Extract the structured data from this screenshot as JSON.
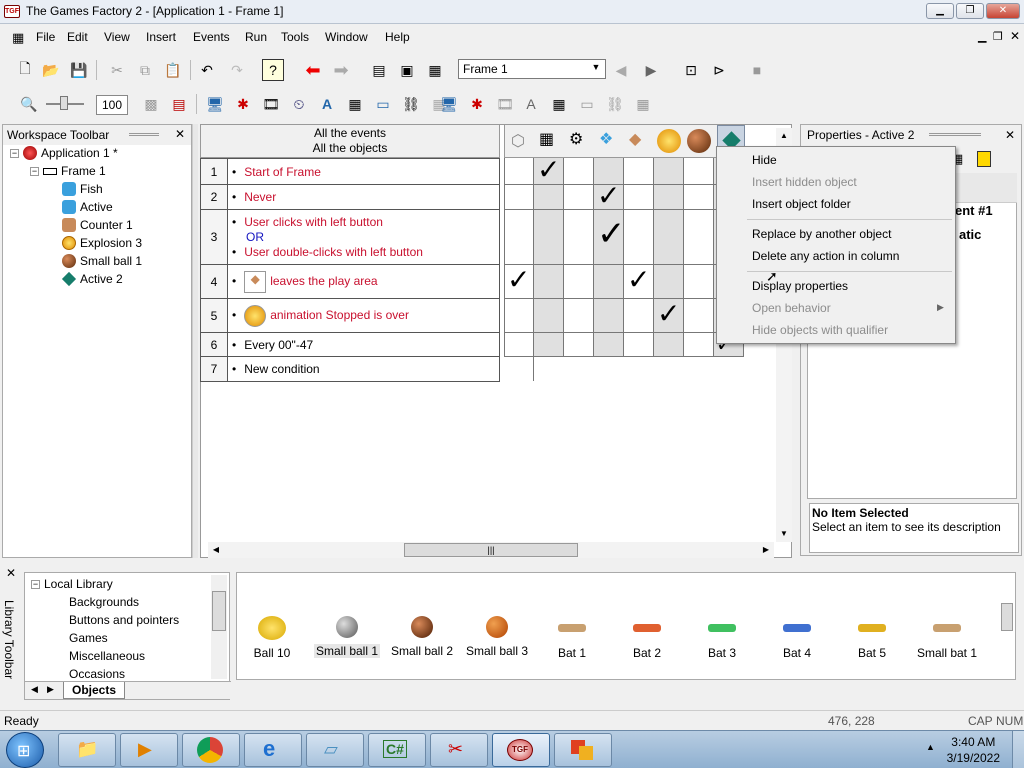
{
  "window": {
    "title": "The Games Factory 2 - [Application 1 - Frame 1]",
    "app_icon": "tgf-logo"
  },
  "menu": [
    "File",
    "Edit",
    "View",
    "Insert",
    "Events",
    "Run",
    "Tools",
    "Window",
    "Help"
  ],
  "toolbar": {
    "frame_select": "Frame 1",
    "zoom": "100"
  },
  "workspace": {
    "header": "Workspace Toolbar",
    "items": [
      {
        "label": "Application 1 *"
      },
      {
        "label": "Frame 1"
      },
      {
        "label": "Fish"
      },
      {
        "label": "Active"
      },
      {
        "label": "Counter 1"
      },
      {
        "label": "Explosion 3"
      },
      {
        "label": "Small ball 1"
      },
      {
        "label": "Active 2"
      }
    ]
  },
  "event_editor": {
    "header_line1": "All the events",
    "header_line2": "All the objects",
    "rows": [
      {
        "num": "1",
        "text": "Start of Frame"
      },
      {
        "num": "2",
        "text": "Never"
      },
      {
        "num": "3",
        "line1": "User clicks with left button",
        "or": "OR",
        "line2": "User double-clicks with left button"
      },
      {
        "num": "4",
        "text": "leaves the play area"
      },
      {
        "num": "5",
        "text": "animation Stopped is over"
      },
      {
        "num": "6",
        "text": "Every 00\"-47"
      },
      {
        "num": "7",
        "text": "New condition"
      }
    ]
  },
  "context_menu": {
    "items": [
      {
        "label": "Hide",
        "enabled": true
      },
      {
        "label": "Insert hidden object",
        "enabled": false
      },
      {
        "label": "Insert object folder",
        "enabled": true
      },
      {
        "label": "Replace by another object",
        "enabled": true
      },
      {
        "label": "Delete any action in column",
        "enabled": true
      },
      {
        "label": "Display properties",
        "enabled": true
      },
      {
        "label": "Open behavior",
        "enabled": false
      },
      {
        "label": "Hide objects with qualifier",
        "enabled": false
      }
    ]
  },
  "properties": {
    "header": "Properties - Active 2",
    "peek1": "ent #1",
    "peek2": "atic",
    "desc_title": "No Item Selected",
    "desc_text": "Select an item to see its description"
  },
  "library": {
    "side_label": "Library Toolbar",
    "tree": [
      "Local Library",
      "Backgrounds",
      "Buttons and pointers",
      "Games",
      "Miscellaneous",
      "Occasions"
    ],
    "tab": "Objects",
    "items": [
      "Ball 10",
      "Small ball 1",
      "Small ball 2",
      "Small ball 3",
      "Bat 1",
      "Bat 2",
      "Bat 3",
      "Bat 4",
      "Bat 5",
      "Small bat 1"
    ]
  },
  "status": {
    "text": "Ready",
    "coords": "476, 228",
    "caps": "CAP",
    "num": "NUM"
  },
  "taskbar": {
    "time": "3:40 AM",
    "date": "3/19/2022"
  }
}
